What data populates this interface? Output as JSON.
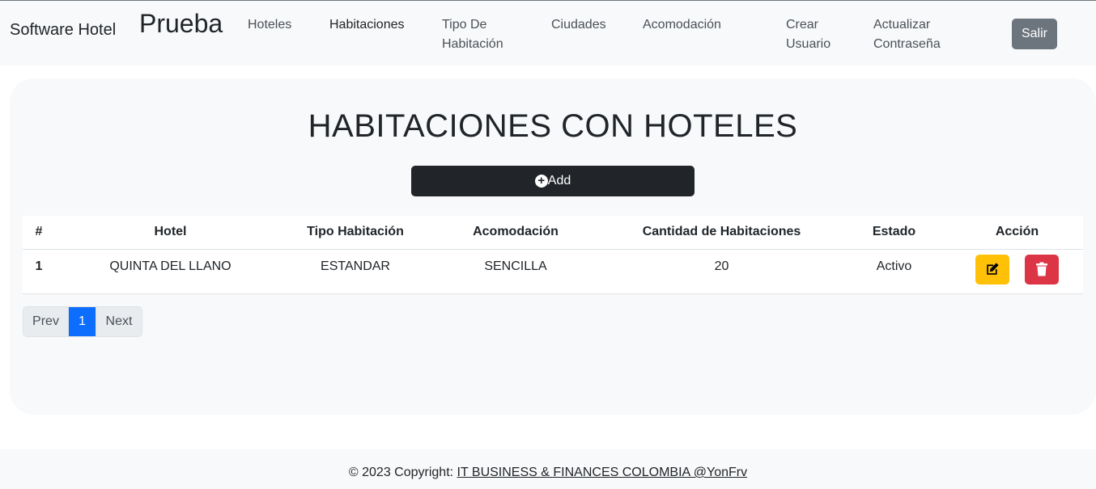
{
  "brand": "Software Hotel",
  "brand_big": "Prueba",
  "nav": [
    {
      "label": "Hoteles"
    },
    {
      "label": "Habitaciones"
    },
    {
      "label": "Tipo De Habitación"
    },
    {
      "label": "Ciudades"
    },
    {
      "label": "Acomodación"
    },
    {
      "label": "Crear Usuario"
    },
    {
      "label": "Actualizar Contraseña"
    }
  ],
  "logout_label": "Salir",
  "title": "HABITACIONES CON HOTELES",
  "add_label": "Add",
  "table": {
    "headers": [
      "#",
      "Hotel",
      "Tipo Habitación",
      "Acomodación",
      "Cantidad de Habitaciones",
      "Estado",
      "Acción"
    ],
    "rows": [
      {
        "num": "1",
        "hotel": "QUINTA DEL LLANO",
        "tipo": "ESTANDAR",
        "acomodacion": "SENCILLA",
        "cantidad": "20",
        "estado": "Activo"
      }
    ]
  },
  "pagination": {
    "prev": "Prev",
    "page": "1",
    "next": "Next"
  },
  "footer": {
    "prefix": "© 2023 Copyright: ",
    "link": "IT BUSINESS & FINANCES COLOMBIA @YonFrv"
  },
  "colors": {
    "edit": "#ffc107",
    "delete": "#dc3545",
    "active_page": "#0d6efd",
    "dark": "#212529"
  }
}
